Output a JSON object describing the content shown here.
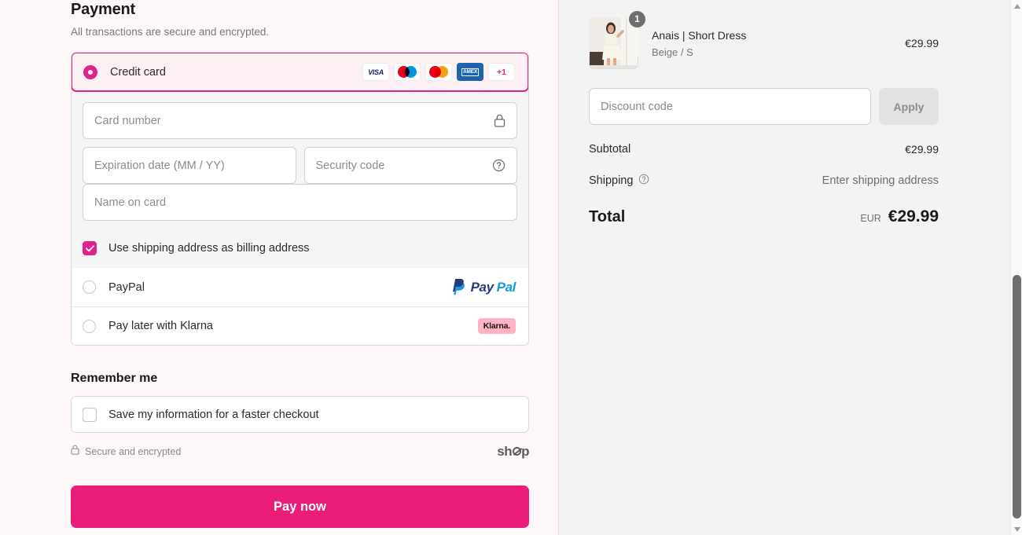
{
  "payment": {
    "title": "Payment",
    "subtitle": "All transactions are secure and encrypted.",
    "accent_color": "#e0218a",
    "methods": [
      {
        "id": "credit-card",
        "label": "Credit card",
        "selected": true,
        "brands": [
          "visa",
          "maestro",
          "mastercard",
          "amex"
        ],
        "more_badge": "+1"
      },
      {
        "id": "paypal",
        "label": "PayPal",
        "selected": false,
        "logo": "paypal-logo",
        "logo_text_a": "Pay",
        "logo_text_b": "Pal"
      },
      {
        "id": "klarna",
        "label": "Pay later with Klarna",
        "selected": false,
        "logo": "klarna-logo",
        "logo_text": "Klarna.",
        "logo_bg": "#ffb3c7"
      }
    ],
    "card_form": {
      "card_number_placeholder": "Card number",
      "card_number_value": "",
      "card_number_icon": "lock-icon",
      "expiration_placeholder": "Expiration date (MM / YY)",
      "expiration_value": "",
      "security_code_placeholder": "Security code",
      "security_code_value": "",
      "security_code_icon": "question-circle-icon",
      "name_on_card_placeholder": "Name on card",
      "name_on_card_value": "",
      "billing_checkbox_label": "Use shipping address as billing address",
      "billing_checkbox_checked": true
    }
  },
  "remember_me": {
    "title": "Remember me",
    "checkbox_label": "Save my information for a faster checkout",
    "checkbox_checked": false
  },
  "footer": {
    "secure_text": "Secure and encrypted",
    "secure_icon": "lock-icon",
    "shop_logo_pre": "sh",
    "shop_logo_post": "p"
  },
  "pay_button": {
    "label": "Pay now",
    "color": "#ea1e79"
  },
  "order_summary": {
    "items": [
      {
        "name": "Anais | Short Dress",
        "variant": "Beige / S",
        "price": "€29.99",
        "quantity": "1",
        "image_alt": "woman-in-beige-short-dress"
      }
    ],
    "discount": {
      "placeholder": "Discount code",
      "value": "",
      "apply_label": "Apply"
    },
    "lines": [
      {
        "label": "Subtotal",
        "value": "€29.99",
        "icon": null,
        "muted": false
      },
      {
        "label": "Shipping",
        "value": "Enter shipping address",
        "icon": "question-circle-icon",
        "muted": true
      }
    ],
    "total": {
      "label": "Total",
      "currency": "EUR",
      "amount": "€29.99"
    }
  }
}
